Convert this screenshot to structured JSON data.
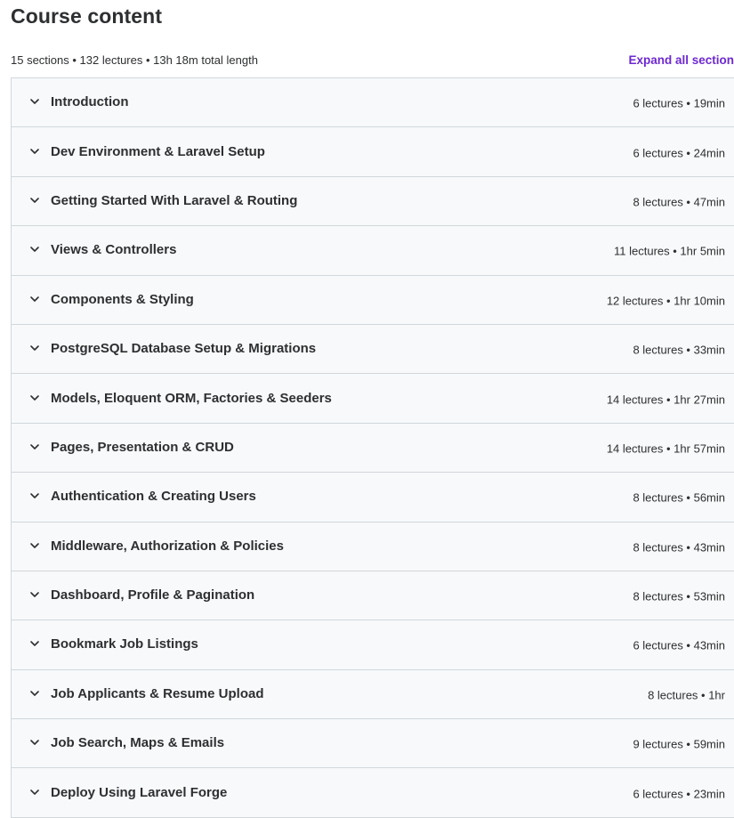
{
  "header": {
    "title": "Course content",
    "summary": "15 sections • 132 lectures • 13h 18m total length",
    "expand_all_label": "Expand all section"
  },
  "icons": {
    "chevron": "chevron-down-icon"
  },
  "colors": {
    "accent": "#6d28d2",
    "row_bg": "#f7f9fa",
    "border": "#d1d7dc",
    "text": "#2d2f31"
  },
  "sections": [
    {
      "title": "Introduction",
      "meta": "6 lectures • 19min"
    },
    {
      "title": "Dev Environment & Laravel Setup",
      "meta": "6 lectures • 24min"
    },
    {
      "title": "Getting Started With Laravel & Routing",
      "meta": "8 lectures • 47min"
    },
    {
      "title": "Views & Controllers",
      "meta": "11 lectures • 1hr 5min"
    },
    {
      "title": "Components & Styling",
      "meta": "12 lectures • 1hr 10min"
    },
    {
      "title": "PostgreSQL Database Setup & Migrations",
      "meta": "8 lectures • 33min"
    },
    {
      "title": "Models, Eloquent ORM, Factories & Seeders",
      "meta": "14 lectures • 1hr 27min"
    },
    {
      "title": "Pages, Presentation & CRUD",
      "meta": "14 lectures • 1hr 57min"
    },
    {
      "title": "Authentication & Creating Users",
      "meta": "8 lectures • 56min"
    },
    {
      "title": "Middleware, Authorization & Policies",
      "meta": "8 lectures • 43min"
    },
    {
      "title": "Dashboard, Profile & Pagination",
      "meta": "8 lectures • 53min"
    },
    {
      "title": "Bookmark Job Listings",
      "meta": "6 lectures • 43min"
    },
    {
      "title": "Job Applicants & Resume Upload",
      "meta": "8 lectures • 1hr"
    },
    {
      "title": "Job Search, Maps & Emails",
      "meta": "9 lectures • 59min"
    },
    {
      "title": "Deploy Using Laravel Forge",
      "meta": "6 lectures • 23min"
    }
  ]
}
